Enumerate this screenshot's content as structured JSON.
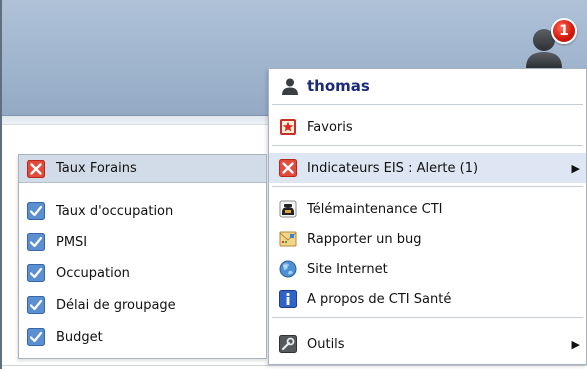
{
  "header": {
    "user_icon": "user-silhouette-icon",
    "notification_count": "1"
  },
  "menu": {
    "username": "thomas",
    "items": [
      {
        "label": "Favoris",
        "icon": "star-bookmark-icon"
      },
      {
        "label": "Indicateurs EIS : Alerte (1)",
        "icon": "red-x-icon",
        "has_submenu": true
      },
      {
        "label": "Télémaintenance CTI",
        "icon": "telephone-icon"
      },
      {
        "label": "Rapporter un bug",
        "icon": "envelope-icon"
      },
      {
        "label": "Site Internet",
        "icon": "globe-icon"
      },
      {
        "label": "A propos de CTI Santé",
        "icon": "info-icon"
      },
      {
        "label": "Outils",
        "icon": "tools-icon",
        "has_submenu": true
      }
    ],
    "arrow": "▶"
  },
  "submenu": {
    "header": {
      "label": "Taux Forains",
      "icon": "red-x-icon"
    },
    "items": [
      {
        "label": "Taux d'occupation",
        "icon": "blue-check-icon"
      },
      {
        "label": "PMSI",
        "icon": "blue-check-icon"
      },
      {
        "label": "Occupation",
        "icon": "blue-check-icon"
      },
      {
        "label": "Délai de groupage",
        "icon": "blue-check-icon"
      },
      {
        "label": "Budget",
        "icon": "blue-check-icon"
      }
    ]
  },
  "colors": {
    "header_blue": "#a3b8d0",
    "username_blue": "#1c2a7a",
    "badge_red": "#d71a0b",
    "hover_row": "#dde6f2",
    "submenu_header": "#d2dbe8"
  }
}
